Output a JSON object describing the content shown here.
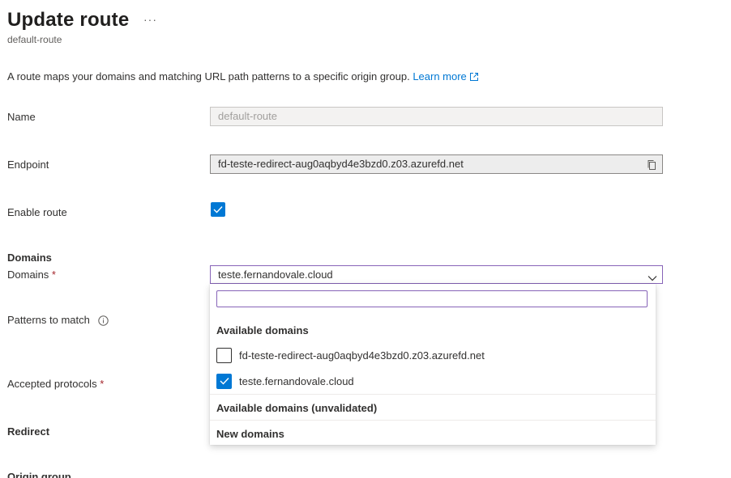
{
  "header": {
    "title": "Update route",
    "more_label": "···",
    "subtitle": "default-route"
  },
  "description": {
    "text": "A route maps your domains and matching URL path patterns to a specific origin group.",
    "link_label": "Learn more"
  },
  "form": {
    "name": {
      "label": "Name",
      "value": "default-route"
    },
    "endpoint": {
      "label": "Endpoint",
      "value": "fd-teste-redirect-aug0aqbyd4e3bzd0.z03.azurefd.net"
    },
    "enable_route": {
      "label": "Enable route",
      "checked": true
    },
    "domains_section": "Domains",
    "domains": {
      "label": "Domains",
      "required_mark": "*",
      "selected_value": "teste.fernandovale.cloud"
    },
    "patterns": {
      "label": "Patterns to match"
    },
    "protocols": {
      "label": "Accepted protocols",
      "required_mark": "*"
    },
    "redirect_section": "Redirect",
    "origin_group_section": "Origin group"
  },
  "dropdown": {
    "search_value": "",
    "group_available": "Available domains",
    "options": [
      {
        "label": "fd-teste-redirect-aug0aqbyd4e3bzd0.z03.azurefd.net",
        "checked": false
      },
      {
        "label": "teste.fernandovale.cloud",
        "checked": true
      }
    ],
    "group_unvalidated": "Available domains (unvalidated)",
    "group_new": "New domains"
  },
  "colors": {
    "accent": "#0078d4",
    "focus_border": "#8764b8",
    "required": "#a4262c"
  }
}
